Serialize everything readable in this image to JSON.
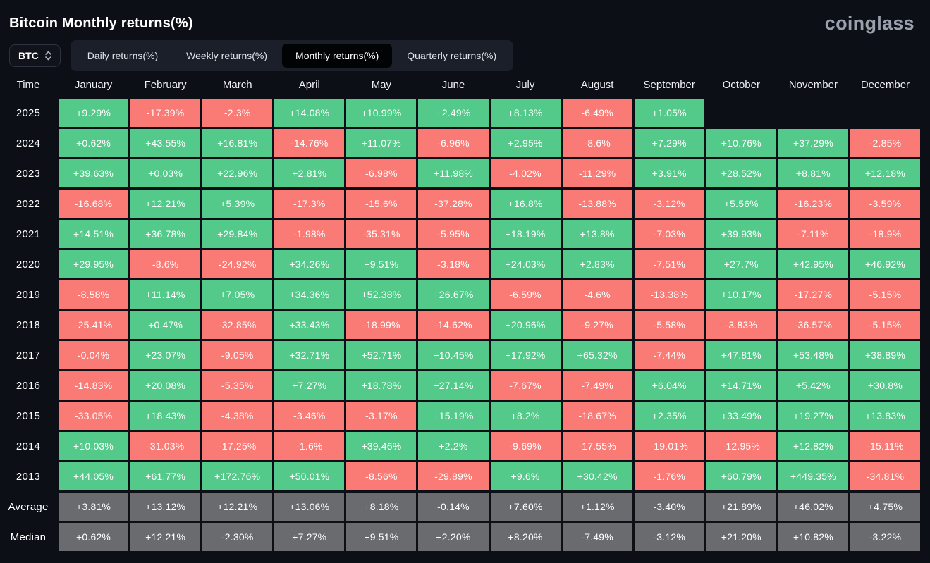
{
  "page": {
    "title": "Bitcoin Monthly returns(%)",
    "logo": "coinglass"
  },
  "controls": {
    "symbol": {
      "value": "BTC"
    },
    "tabs": [
      {
        "label": "Daily returns(%)",
        "active": false
      },
      {
        "label": "Weekly returns(%)",
        "active": false
      },
      {
        "label": "Monthly returns(%)",
        "active": true
      },
      {
        "label": "Quarterly returns(%)",
        "active": false
      }
    ]
  },
  "colors": {
    "positive": "#53c98a",
    "negative": "#fa7a75",
    "neutral": "#6a6b6f",
    "background": "#0c0f15"
  },
  "chart_data": {
    "type": "table",
    "columns": [
      "Time",
      "January",
      "February",
      "March",
      "April",
      "May",
      "June",
      "July",
      "August",
      "September",
      "October",
      "November",
      "December"
    ],
    "rows": [
      {
        "label": "2025",
        "kind": "year",
        "values": [
          "+9.29%",
          "-17.39%",
          "-2.3%",
          "+14.08%",
          "+10.99%",
          "+2.49%",
          "+8.13%",
          "-6.49%",
          "+1.05%",
          "",
          "",
          ""
        ]
      },
      {
        "label": "2024",
        "kind": "year",
        "values": [
          "+0.62%",
          "+43.55%",
          "+16.81%",
          "-14.76%",
          "+11.07%",
          "-6.96%",
          "+2.95%",
          "-8.6%",
          "+7.29%",
          "+10.76%",
          "+37.29%",
          "-2.85%"
        ]
      },
      {
        "label": "2023",
        "kind": "year",
        "values": [
          "+39.63%",
          "+0.03%",
          "+22.96%",
          "+2.81%",
          "-6.98%",
          "+11.98%",
          "-4.02%",
          "-11.29%",
          "+3.91%",
          "+28.52%",
          "+8.81%",
          "+12.18%"
        ]
      },
      {
        "label": "2022",
        "kind": "year",
        "values": [
          "-16.68%",
          "+12.21%",
          "+5.39%",
          "-17.3%",
          "-15.6%",
          "-37.28%",
          "+16.8%",
          "-13.88%",
          "-3.12%",
          "+5.56%",
          "-16.23%",
          "-3.59%"
        ]
      },
      {
        "label": "2021",
        "kind": "year",
        "values": [
          "+14.51%",
          "+36.78%",
          "+29.84%",
          "-1.98%",
          "-35.31%",
          "-5.95%",
          "+18.19%",
          "+13.8%",
          "-7.03%",
          "+39.93%",
          "-7.11%",
          "-18.9%"
        ]
      },
      {
        "label": "2020",
        "kind": "year",
        "values": [
          "+29.95%",
          "-8.6%",
          "-24.92%",
          "+34.26%",
          "+9.51%",
          "-3.18%",
          "+24.03%",
          "+2.83%",
          "-7.51%",
          "+27.7%",
          "+42.95%",
          "+46.92%"
        ]
      },
      {
        "label": "2019",
        "kind": "year",
        "values": [
          "-8.58%",
          "+11.14%",
          "+7.05%",
          "+34.36%",
          "+52.38%",
          "+26.67%",
          "-6.59%",
          "-4.6%",
          "-13.38%",
          "+10.17%",
          "-17.27%",
          "-5.15%"
        ]
      },
      {
        "label": "2018",
        "kind": "year",
        "values": [
          "-25.41%",
          "+0.47%",
          "-32.85%",
          "+33.43%",
          "-18.99%",
          "-14.62%",
          "+20.96%",
          "-9.27%",
          "-5.58%",
          "-3.83%",
          "-36.57%",
          "-5.15%"
        ]
      },
      {
        "label": "2017",
        "kind": "year",
        "values": [
          "-0.04%",
          "+23.07%",
          "-9.05%",
          "+32.71%",
          "+52.71%",
          "+10.45%",
          "+17.92%",
          "+65.32%",
          "-7.44%",
          "+47.81%",
          "+53.48%",
          "+38.89%"
        ]
      },
      {
        "label": "2016",
        "kind": "year",
        "values": [
          "-14.83%",
          "+20.08%",
          "-5.35%",
          "+7.27%",
          "+18.78%",
          "+27.14%",
          "-7.67%",
          "-7.49%",
          "+6.04%",
          "+14.71%",
          "+5.42%",
          "+30.8%"
        ]
      },
      {
        "label": "2015",
        "kind": "year",
        "values": [
          "-33.05%",
          "+18.43%",
          "-4.38%",
          "-3.46%",
          "-3.17%",
          "+15.19%",
          "+8.2%",
          "-18.67%",
          "+2.35%",
          "+33.49%",
          "+19.27%",
          "+13.83%"
        ]
      },
      {
        "label": "2014",
        "kind": "year",
        "values": [
          "+10.03%",
          "-31.03%",
          "-17.25%",
          "-1.6%",
          "+39.46%",
          "+2.2%",
          "-9.69%",
          "-17.55%",
          "-19.01%",
          "-12.95%",
          "+12.82%",
          "-15.11%"
        ]
      },
      {
        "label": "2013",
        "kind": "year",
        "values": [
          "+44.05%",
          "+61.77%",
          "+172.76%",
          "+50.01%",
          "-8.56%",
          "-29.89%",
          "+9.6%",
          "+30.42%",
          "-1.76%",
          "+60.79%",
          "+449.35%",
          "-34.81%"
        ]
      },
      {
        "label": "Average",
        "kind": "summary",
        "values": [
          "+3.81%",
          "+13.12%",
          "+12.21%",
          "+13.06%",
          "+8.18%",
          "-0.14%",
          "+7.60%",
          "+1.12%",
          "-3.40%",
          "+21.89%",
          "+46.02%",
          "+4.75%"
        ]
      },
      {
        "label": "Median",
        "kind": "summary",
        "values": [
          "+0.62%",
          "+12.21%",
          "-2.30%",
          "+7.27%",
          "+9.51%",
          "+2.20%",
          "+8.20%",
          "-7.49%",
          "-3.12%",
          "+21.20%",
          "+10.82%",
          "-3.22%"
        ]
      }
    ]
  }
}
